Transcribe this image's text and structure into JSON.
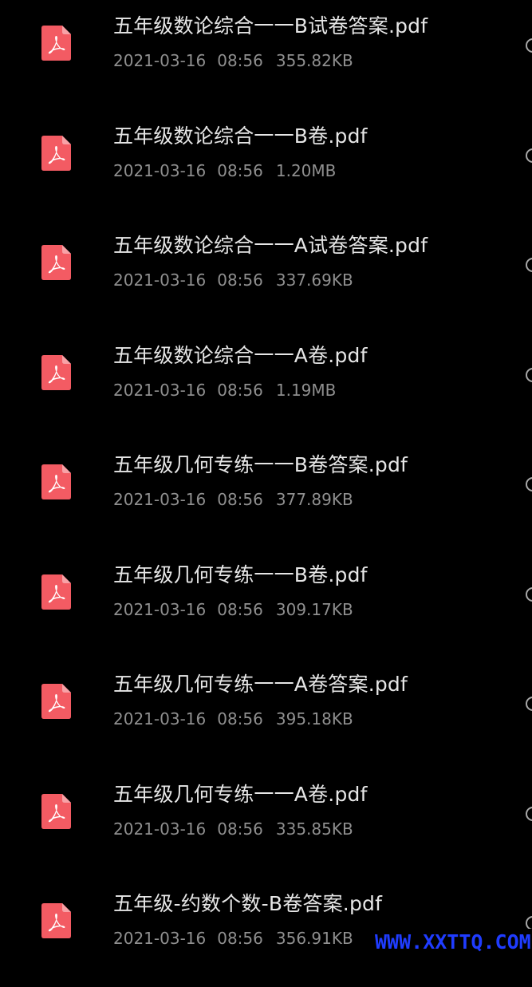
{
  "file_list": {
    "items": [
      {
        "name": "五年级数论综合一一B试卷答案.pdf",
        "date": "2021-03-16",
        "time": "08:56",
        "size": "355.82KB",
        "icon": "pdf-icon"
      },
      {
        "name": "五年级数论综合一一B卷.pdf",
        "date": "2021-03-16",
        "time": "08:56",
        "size": "1.20MB",
        "icon": "pdf-icon"
      },
      {
        "name": "五年级数论综合一一A试卷答案.pdf",
        "date": "2021-03-16",
        "time": "08:56",
        "size": "337.69KB",
        "icon": "pdf-icon"
      },
      {
        "name": "五年级数论综合一一A卷.pdf",
        "date": "2021-03-16",
        "time": "08:56",
        "size": "1.19MB",
        "icon": "pdf-icon"
      },
      {
        "name": "五年级几何专练一一B卷答案.pdf",
        "date": "2021-03-16",
        "time": "08:56",
        "size": "377.89KB",
        "icon": "pdf-icon"
      },
      {
        "name": "五年级几何专练一一B卷.pdf",
        "date": "2021-03-16",
        "time": "08:56",
        "size": "309.17KB",
        "icon": "pdf-icon"
      },
      {
        "name": "五年级几何专练一一A卷答案.pdf",
        "date": "2021-03-16",
        "time": "08:56",
        "size": "395.18KB",
        "icon": "pdf-icon"
      },
      {
        "name": "五年级几何专练一一A卷.pdf",
        "date": "2021-03-16",
        "time": "08:56",
        "size": "335.85KB",
        "icon": "pdf-icon"
      },
      {
        "name": "五年级-约数个数-B卷答案.pdf",
        "date": "2021-03-16",
        "time": "08:56",
        "size": "356.91KB",
        "icon": "pdf-icon"
      }
    ]
  },
  "watermark": {
    "text": "WWW.XXTTQ.COM"
  },
  "colors": {
    "background": "#000000",
    "file_name": "#e6e6e6",
    "file_meta": "#8f8f8f",
    "pdf_icon": "#f35b63",
    "watermark": "#1f3cff"
  }
}
